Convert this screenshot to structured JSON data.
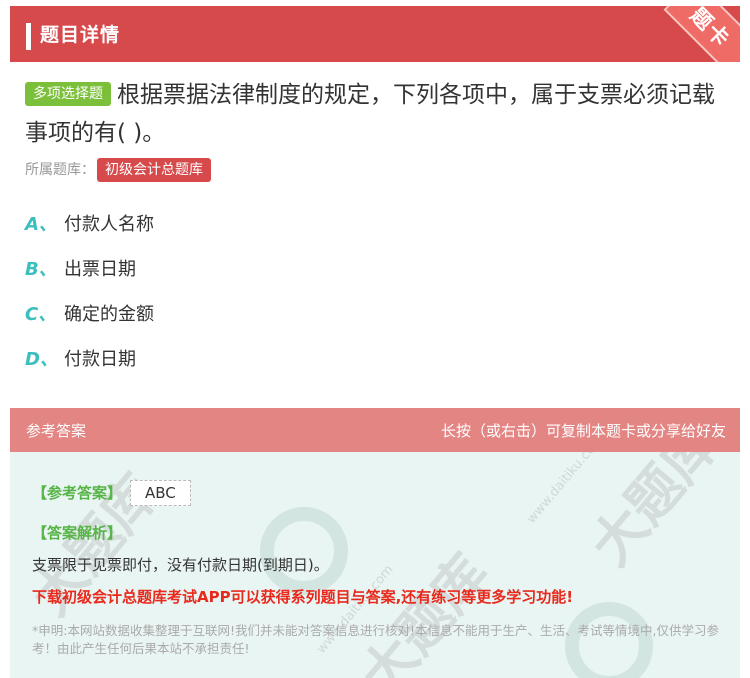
{
  "header": {
    "title": "题目详情",
    "badge": "题卡"
  },
  "question": {
    "type_tag": "多项选择题",
    "text": "根据票据法律制度的规定，下列各项中，属于支票必须记载事项的有( )。",
    "source_label": "所属题库：",
    "source_tag": "初级会计总题库"
  },
  "options": [
    {
      "letter": "A、",
      "text": "付款人名称"
    },
    {
      "letter": "B、",
      "text": "出票日期"
    },
    {
      "letter": "C、",
      "text": "确定的金额"
    },
    {
      "letter": "D、",
      "text": "付款日期"
    }
  ],
  "answer": {
    "section_label": "参考答案",
    "hint": "长按（或右击）可复制本题卡或分享给好友",
    "ref_label": "【参考答案】",
    "ref_value": "ABC",
    "analysis_label": "【答案解析】",
    "analysis_text": "支票限于见票即付，没有付款日期(到期日)。",
    "promo": "下载初级会计总题库考试APP可以获得系列题目与答案,还有练习等更多学习功能!",
    "disclaimer": "*申明:本网站数据收集整理于互联网!我们并未能对答案信息进行核对!本信息不能用于生产、生活、考试等情境中,仅供学习参考！由此产生任何后果本站不承担责任!"
  },
  "watermark": {
    "text": "大题库",
    "domain": "www.daitiku.com"
  }
}
